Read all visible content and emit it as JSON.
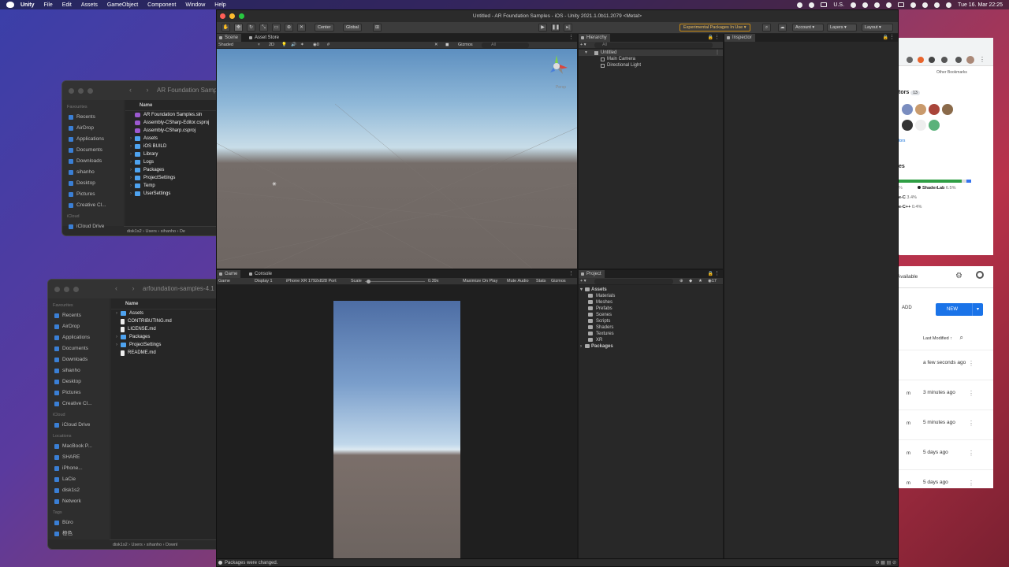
{
  "menubar": {
    "app": "Unity",
    "items": [
      "File",
      "Edit",
      "Assets",
      "GameObject",
      "Component",
      "Window",
      "Help"
    ],
    "input_source": "U.S.",
    "clock": "Tue 16. Mar  22:25"
  },
  "finder1": {
    "title": "AR Foundation Samp",
    "sidebar": {
      "favorites_label": "Favourites",
      "items": [
        "Recents",
        "AirDrop",
        "Applications",
        "Documents",
        "Downloads",
        "sihanho",
        "Desktop",
        "Pictures",
        "Creative Cl..."
      ],
      "icloud_label": "iCloud",
      "icloud_items": [
        "iCloud Drive"
      ]
    },
    "column_header": "Name",
    "rows": [
      {
        "name": "AR Foundation Samples.sln",
        "kind": "sln"
      },
      {
        "name": "Assembly-CSharp-Editor.csproj",
        "kind": "sln"
      },
      {
        "name": "Assembly-CSharp.csproj",
        "kind": "sln"
      },
      {
        "name": "Assets",
        "kind": "folder"
      },
      {
        "name": "iOS BUILD",
        "kind": "folder"
      },
      {
        "name": "Library",
        "kind": "folder"
      },
      {
        "name": "Logs",
        "kind": "folder"
      },
      {
        "name": "Packages",
        "kind": "folder"
      },
      {
        "name": "ProjectSettings",
        "kind": "folder"
      },
      {
        "name": "Temp",
        "kind": "folder"
      },
      {
        "name": "UserSettings",
        "kind": "folder"
      }
    ],
    "path": "disk1s2 › Users › sihanho › De"
  },
  "finder2": {
    "title": "arfoundation-samples-4.1",
    "sidebar": {
      "favorites_label": "Favourites",
      "items": [
        "Recents",
        "AirDrop",
        "Applications",
        "Documents",
        "Downloads",
        "sihanho",
        "Desktop",
        "Pictures",
        "Creative Cl..."
      ],
      "icloud_label": "iCloud",
      "icloud_items": [
        "iCloud Drive"
      ],
      "locations_label": "Locations",
      "location_items": [
        "MacBook P...",
        "SHARE",
        "iPhone...",
        "LaCie",
        "disk1s2",
        "Network"
      ],
      "tags_label": "Tags",
      "tag_items": [
        "Büro",
        "橙色"
      ]
    },
    "column_header": "Name",
    "rows": [
      {
        "name": "Assets",
        "kind": "folder"
      },
      {
        "name": "CONTRIBUTING.md",
        "kind": "file"
      },
      {
        "name": "LICENSE.md",
        "kind": "file"
      },
      {
        "name": "Packages",
        "kind": "folder"
      },
      {
        "name": "ProjectSettings",
        "kind": "folder"
      },
      {
        "name": "README.md",
        "kind": "file"
      }
    ],
    "path": "disk1s2 › Users › sihanho › Downl"
  },
  "browser": {
    "bookmarks": "Other Bookmarks",
    "contributors_label": "tors",
    "contributors_count": "13",
    "more_link": "tors",
    "languages_label": "es",
    "languages": [
      {
        "name": "ShaderLab",
        "pct": "6.5%",
        "color": "#222222"
      },
      {
        "name": "e-C",
        "pct": "3.4%",
        "color": "#555555"
      },
      {
        "name": "e-C++",
        "pct": "0.4%",
        "color": "#f34b7d"
      }
    ]
  },
  "drive": {
    "available": "Available",
    "add_label": "ADD",
    "new_label": "NEW",
    "sort_label": "Last Modified",
    "rows": [
      {
        "m": "",
        "t": "a few seconds ago"
      },
      {
        "m": "m",
        "t": "3 minutes ago"
      },
      {
        "m": "m",
        "t": "5 minutes ago"
      },
      {
        "m": "m",
        "t": "5 days ago"
      },
      {
        "m": "m",
        "t": "5 days ago"
      }
    ]
  },
  "unity": {
    "window_title": "Untitled - AR Foundation Samples - iOS - Unity 2021.1.0b11.2079 <Metal>",
    "toolbar": {
      "center": "Center",
      "global": "Global",
      "experimental": "Experimental Packages In Use ▾",
      "account": "Account",
      "layers": "Layers",
      "layout": "Layout"
    },
    "scene": {
      "tabs": [
        "Scene",
        "Asset Store"
      ],
      "shading": "Shaded",
      "mode_2d": "2D",
      "gizmos": "Gizmos",
      "search_placeholder": "All",
      "persp": "Persp"
    },
    "game": {
      "tabs": [
        "Game",
        "Console"
      ],
      "display_mode": "Game",
      "display": "Display 1",
      "resolution": "iPhone XR 1792x828 Port",
      "scale_label": "Scale",
      "scale_value": "0.39x",
      "maximize": "Maximize On Play",
      "mute": "Mute Audio",
      "stats": "Stats",
      "gizmos": "Gizmos"
    },
    "hierarchy": {
      "tab": "Hierarchy",
      "search_placeholder": "All",
      "scene_name": "Untitled",
      "objects": [
        "Main Camera",
        "Directional Light"
      ]
    },
    "inspector": {
      "tab": "Inspector"
    },
    "project": {
      "tab": "Project",
      "hidden_count": "17",
      "root": "Assets",
      "folders": [
        "Materials",
        "Meshes",
        "Prefabs",
        "Scenes",
        "Scripts",
        "Shaders",
        "Textures",
        "XR"
      ],
      "packages": "Packages"
    },
    "status": "Packages were changed."
  }
}
